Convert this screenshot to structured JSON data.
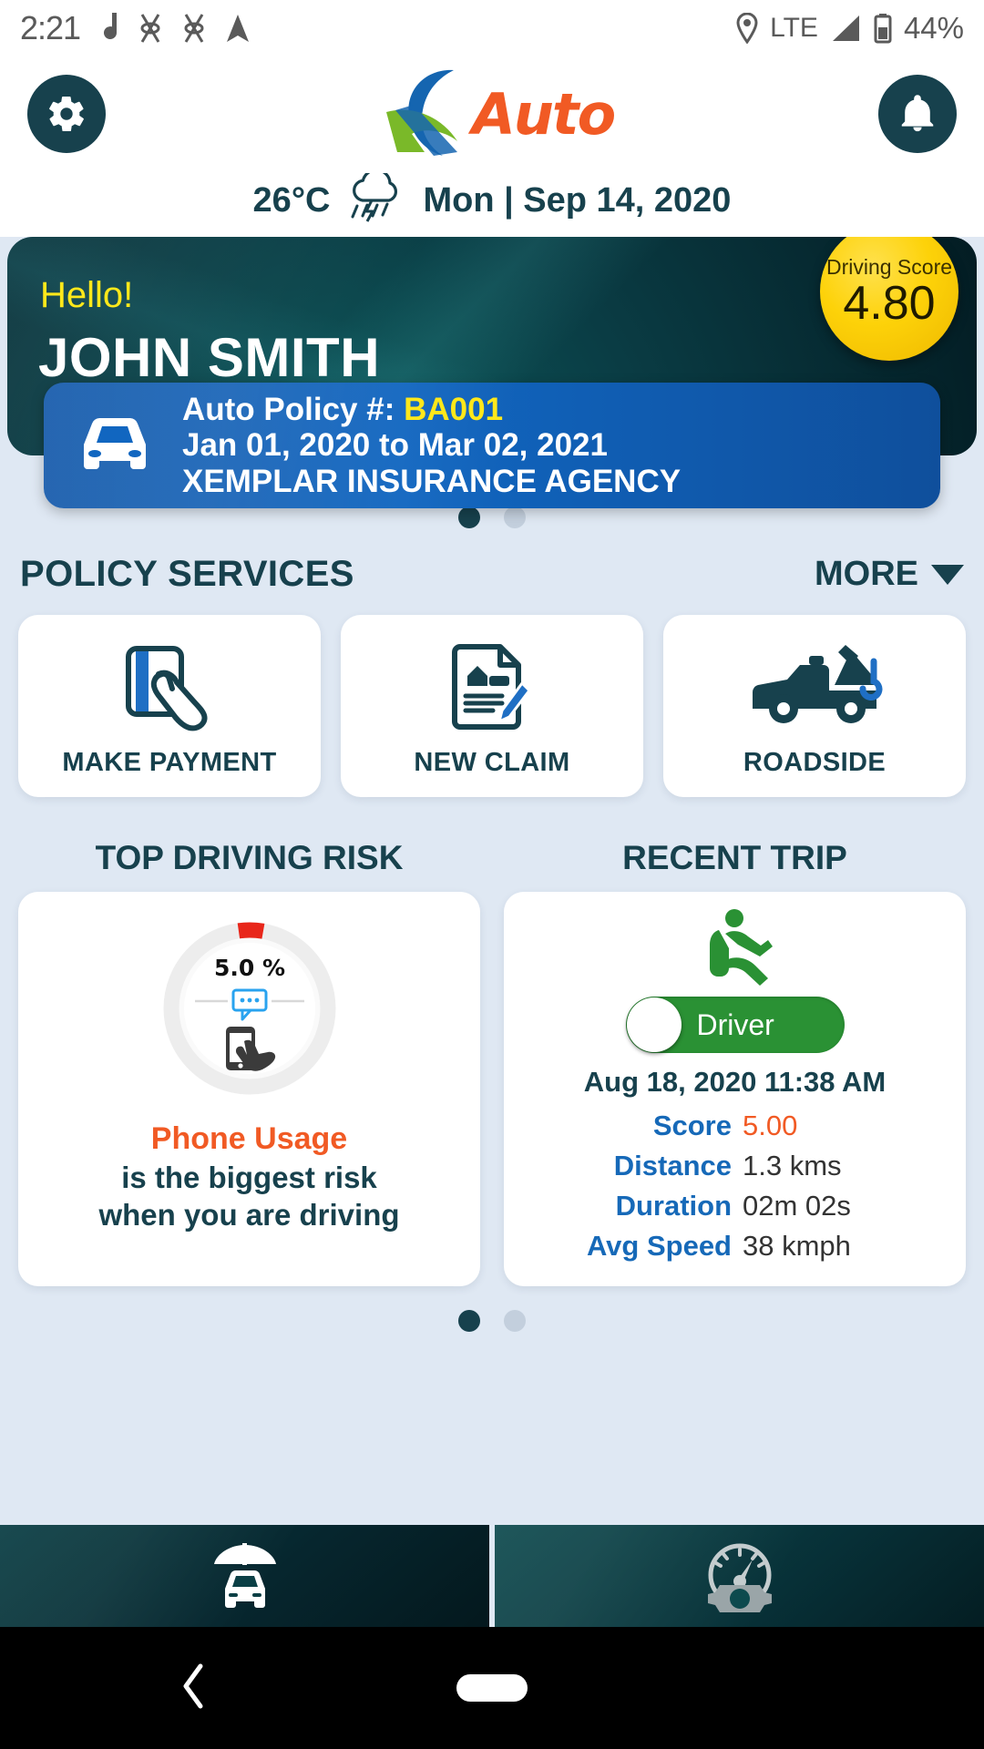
{
  "status_bar": {
    "time": "2:21",
    "network": "LTE",
    "battery": "44%",
    "icons": [
      "music-note-icon",
      "vibrate-icon",
      "vibrate-icon",
      "navigation-icon",
      "location-pin-icon",
      "signal-bars-icon",
      "battery-icon"
    ]
  },
  "header": {
    "settings_icon": "gear-icon",
    "notification_icon": "bell-icon",
    "logo_text": "Auto",
    "logo_colors": {
      "blue": "#1565b0",
      "green": "#7ab929",
      "orange": "#f15a24"
    }
  },
  "weather": {
    "temperature": "26°C",
    "icon": "rain-cloud-icon",
    "date": "Mon | Sep 14, 2020"
  },
  "hero": {
    "greeting": "Hello!",
    "user_name": "JOHN SMITH",
    "score_label": "Driving Score",
    "score_value": "4.80",
    "score_color": "#fdd209",
    "policy": {
      "icon": "car-icon",
      "label": "Auto Policy #:",
      "number": "BA001",
      "number_color": "#ffe81a",
      "period": "Jan 01, 2020 to Mar 02, 2021",
      "agency": "XEMPLAR INSURANCE AGENCY"
    }
  },
  "carousel_top": {
    "count": 2,
    "active": 0
  },
  "policy_services": {
    "title": "POLICY SERVICES",
    "more_label": "MORE",
    "more_icon": "chevron-down-icon",
    "items": [
      {
        "label": "MAKE PAYMENT",
        "icon": "credit-card-hand-icon"
      },
      {
        "label": "NEW CLAIM",
        "icon": "claim-document-icon"
      },
      {
        "label": "ROADSIDE",
        "icon": "tow-truck-icon"
      }
    ]
  },
  "top_driving_risk": {
    "title": "TOP DRIVING RISK",
    "gauge_value": "5.0 %",
    "gauge_percent": 5,
    "gauge_color": "#e8261a",
    "gauge_track_color": "#ededed",
    "inner_icons": [
      "chat-bubble-icon",
      "phone-tap-icon"
    ],
    "risk_name": "Phone Usage",
    "risk_name_color": "#f15a24",
    "risk_sub_line1": "is the biggest risk",
    "risk_sub_line2": "when you are driving"
  },
  "recent_trip": {
    "title": "RECENT TRIP",
    "person_icon": "seated-driver-icon",
    "toggle_label": "Driver",
    "toggle_on": true,
    "toggle_color": "#2a9134",
    "date": "Aug 18, 2020 11:38 AM",
    "stats": [
      {
        "key": "Score",
        "value": "5.00",
        "accent": true
      },
      {
        "key": "Distance",
        "value": "1.3 kms",
        "accent": false
      },
      {
        "key": "Duration",
        "value": "02m 02s",
        "accent": false
      },
      {
        "key": "Avg Speed",
        "value": "38 kmph",
        "accent": false
      }
    ]
  },
  "carousel_bottom": {
    "count": 2,
    "active": 0
  },
  "bottom_nav": {
    "items": [
      {
        "icon": "car-umbrella-icon",
        "name": "insurance-tab"
      },
      {
        "icon": "speedometer-gear-icon",
        "name": "telematics-tab"
      }
    ]
  },
  "android_nav": {
    "back_icon": "back-chevron-icon",
    "home_icon": "home-pill-icon"
  }
}
